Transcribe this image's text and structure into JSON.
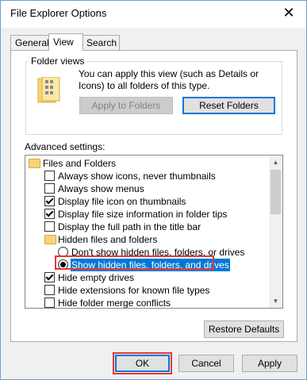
{
  "window": {
    "title": "File Explorer Options"
  },
  "tabs": [
    {
      "label": "General"
    },
    {
      "label": "View"
    },
    {
      "label": "Search"
    }
  ],
  "folder_views": {
    "label": "Folder views",
    "description": "You can apply this view (such as Details or Icons) to all folders of this type.",
    "apply_button": "Apply to Folders",
    "reset_button": "Reset Folders"
  },
  "advanced": {
    "label": "Advanced settings:",
    "items": [
      {
        "type": "folder",
        "label": "Files and Folders"
      },
      {
        "type": "checkbox",
        "checked": false,
        "label": "Always show icons, never thumbnails"
      },
      {
        "type": "checkbox",
        "checked": false,
        "label": "Always show menus"
      },
      {
        "type": "checkbox",
        "checked": true,
        "label": "Display file icon on thumbnails"
      },
      {
        "type": "checkbox",
        "checked": true,
        "label": "Display file size information in folder tips"
      },
      {
        "type": "checkbox",
        "checked": false,
        "label": "Display the full path in the title bar"
      },
      {
        "type": "folder",
        "label": "Hidden files and folders"
      },
      {
        "type": "radio",
        "checked": false,
        "label": "Don't show hidden files, folders, or drives"
      },
      {
        "type": "radio",
        "checked": true,
        "label": "Show hidden files, folders, and drives"
      },
      {
        "type": "checkbox",
        "checked": true,
        "label": "Hide empty drives"
      },
      {
        "type": "checkbox",
        "checked": false,
        "label": "Hide extensions for known file types"
      },
      {
        "type": "checkbox",
        "checked": false,
        "label": "Hide folder merge conflicts"
      }
    ],
    "restore_button": "Restore Defaults"
  },
  "footer": {
    "ok": "OK",
    "cancel": "Cancel",
    "apply": "Apply"
  },
  "colors": {
    "accent": "#0078d7",
    "highlight_red": "#e53935"
  }
}
